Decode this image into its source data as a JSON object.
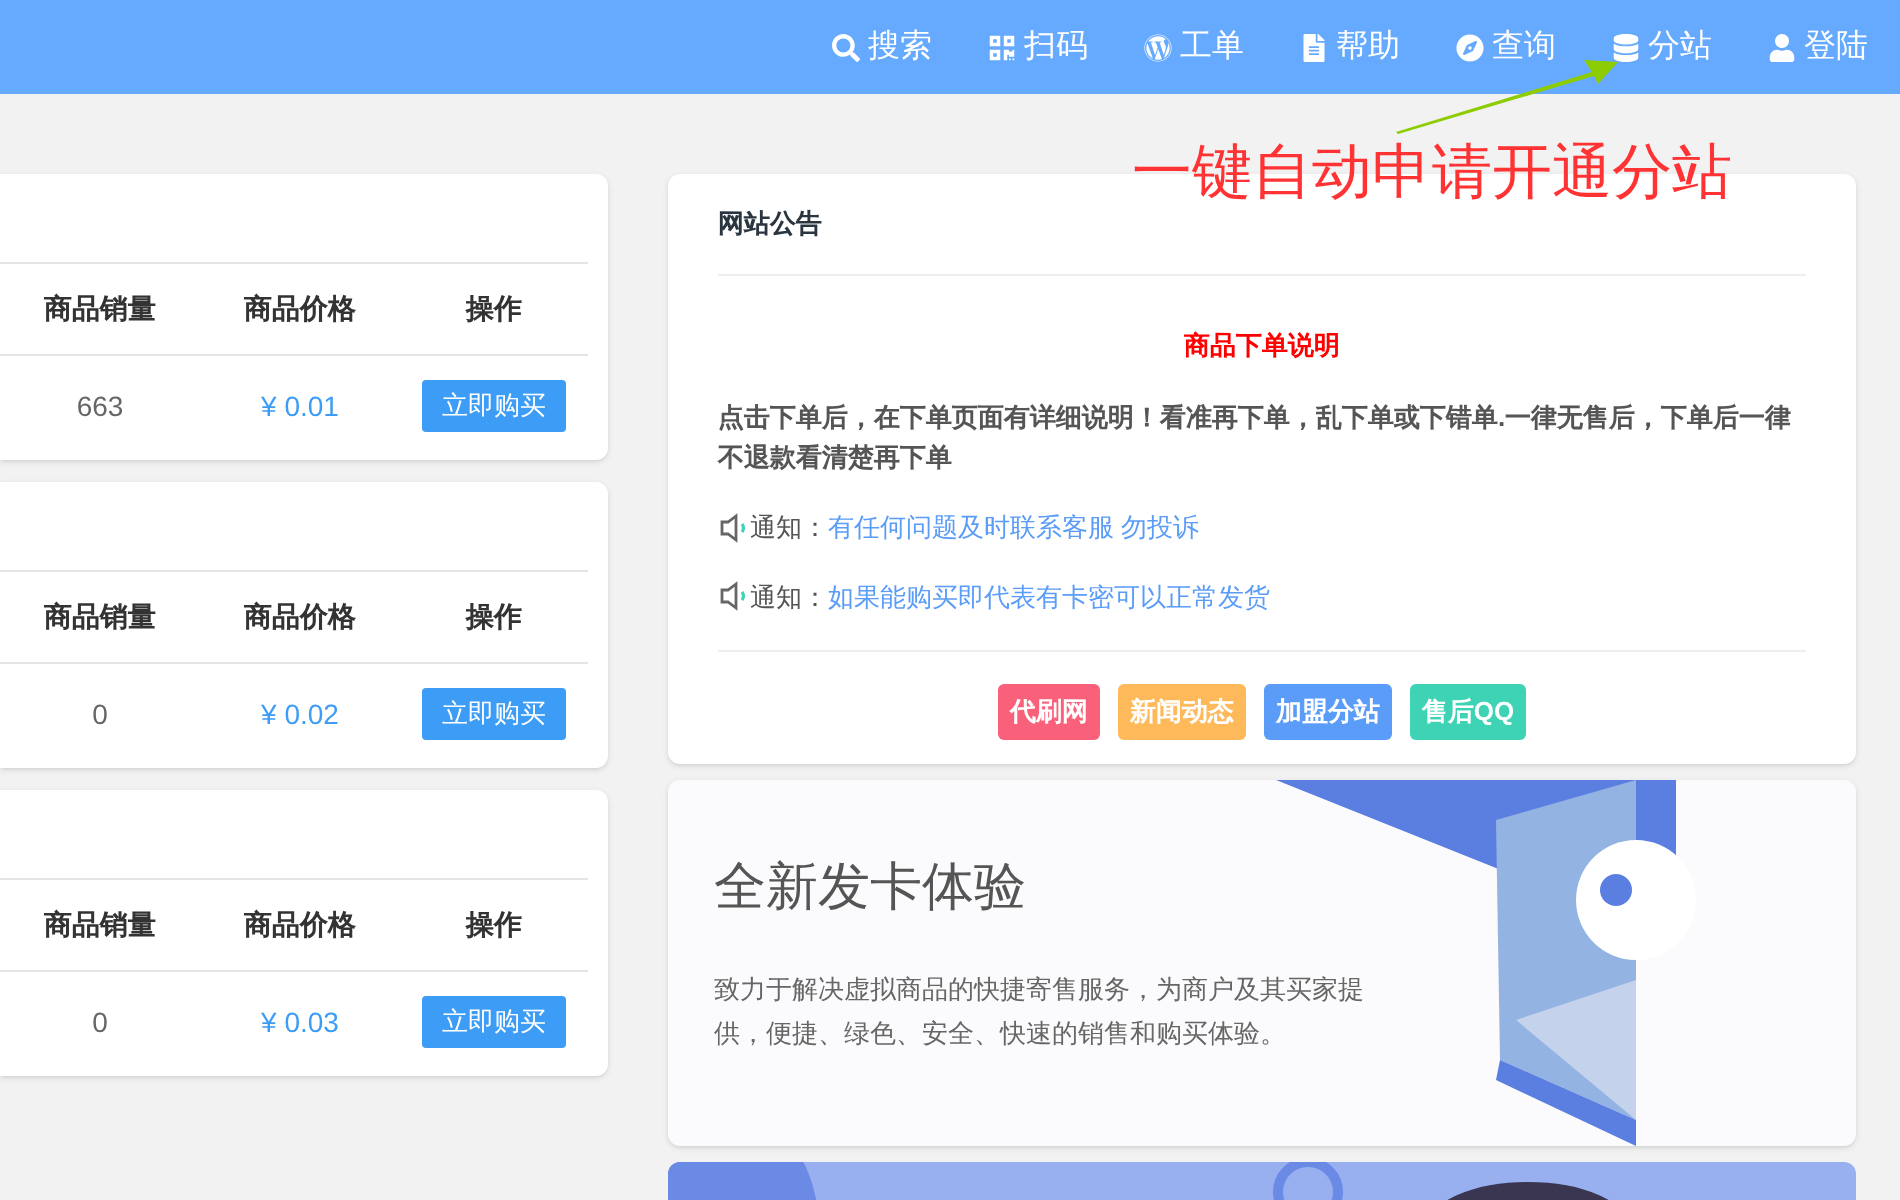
{
  "nav": {
    "items": [
      {
        "label": "搜索"
      },
      {
        "label": "扫码"
      },
      {
        "label": "工单"
      },
      {
        "label": "帮助"
      },
      {
        "label": "查询"
      },
      {
        "label": "分站"
      },
      {
        "label": "登陆"
      }
    ]
  },
  "annotation": "一键自动申请开通分站",
  "products": [
    {
      "columns": [
        "商品销量",
        "商品价格",
        "操作"
      ],
      "sales": "663",
      "price": "¥ 0.01",
      "button": "立即购买"
    },
    {
      "columns": [
        "商品销量",
        "商品价格",
        "操作"
      ],
      "sales": "0",
      "price": "¥ 0.02",
      "button": "立即购买"
    },
    {
      "columns": [
        "商品销量",
        "商品价格",
        "操作"
      ],
      "sales": "0",
      "price": "¥ 0.03",
      "button": "立即购买"
    }
  ],
  "notice": {
    "title": "网站公告",
    "heading": "商品下单说明",
    "body": "点击下单后，在下单页面有详细说明！看准再下单，乱下单或下错单.一律无售后，下单后一律不退款看清楚再下单",
    "notices": [
      {
        "label": "通知：",
        "link": "有任何问题及时联系客服 勿投诉"
      },
      {
        "label": "通知：",
        "link": "如果能购买即代表有卡密可以正常发货"
      }
    ],
    "buttons": [
      {
        "label": "代刷网",
        "color": "#f9617a"
      },
      {
        "label": "新闻动态",
        "color": "#fdb95a"
      },
      {
        "label": "加盟分站",
        "color": "#5a9cf8"
      },
      {
        "label": "售后QQ",
        "color": "#3ed3b4"
      }
    ]
  },
  "banner": {
    "title": "全新发卡体验",
    "text": "致力于解决虚拟商品的快捷寄售服务，为商户及其买家提供，便捷、绿色、安全、快速的销售和购买体验。"
  }
}
